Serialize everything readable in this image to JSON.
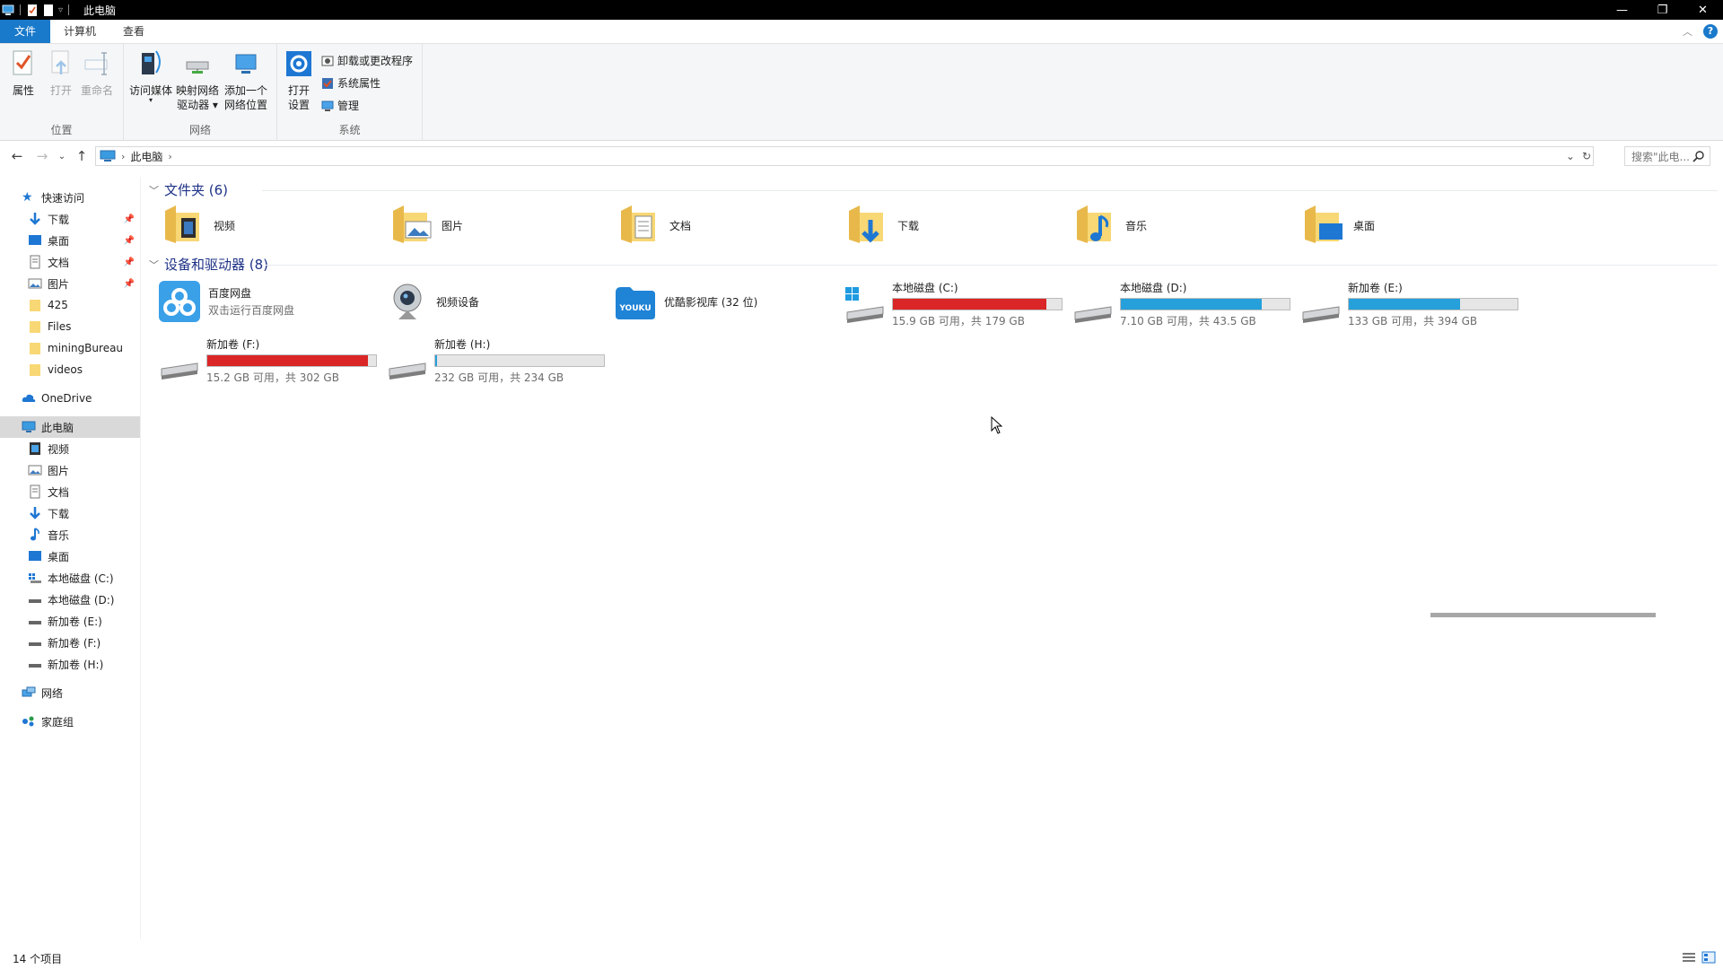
{
  "window": {
    "title": "此电脑",
    "controls": {
      "minimize": "—",
      "restore": "❐",
      "close": "✕"
    }
  },
  "ribbon": {
    "tabs": [
      "文件",
      "计算机",
      "查看"
    ],
    "location": {
      "label": "位置",
      "properties": "属性",
      "open": "打开",
      "rename": "重命名"
    },
    "network": {
      "label": "网络",
      "access_media": "访问媒体",
      "map_drive_1": "映射网络",
      "map_drive_2": "驱动器 ▾",
      "add_location_1": "添加一个",
      "add_location_2": "网络位置"
    },
    "system": {
      "label": "系统",
      "open_settings_1": "打开",
      "open_settings_2": "设置",
      "uninstall": "卸载或更改程序",
      "sys_props": "系统属性",
      "manage": "管理"
    }
  },
  "address": {
    "crumbs": [
      "此电脑"
    ],
    "search_placeholder": "搜索\"此电..."
  },
  "sidebar": {
    "quick_access": "快速访问",
    "quick_items": [
      "下载",
      "桌面",
      "文档",
      "图片",
      "425",
      "Files",
      "miningBureau",
      "videos"
    ],
    "onedrive": "OneDrive",
    "this_pc": "此电脑",
    "pc_items": [
      "视频",
      "图片",
      "文档",
      "下载",
      "音乐",
      "桌面",
      "本地磁盘 (C:)",
      "本地磁盘 (D:)",
      "新加卷 (E:)",
      "新加卷 (F:)",
      "新加卷 (H:)"
    ],
    "network": "网络",
    "homegroup": "家庭组"
  },
  "folders": {
    "header": "文件夹 (6)",
    "items": [
      "视频",
      "图片",
      "文档",
      "下载",
      "音乐",
      "桌面"
    ]
  },
  "devices": {
    "header": "设备和驱动器 (8)",
    "baidu": {
      "name": "百度网盘",
      "sub": "双击运行百度网盘"
    },
    "camera": {
      "name": "视频设备"
    },
    "youku": {
      "name": "优酷影视库 (32 位)"
    },
    "drives": [
      {
        "name": "本地磁盘 (C:)",
        "sub": "15.9 GB 可用，共 179 GB",
        "used_fraction": 0.911,
        "color": "#da2626"
      },
      {
        "name": "本地磁盘 (D:)",
        "sub": "7.10 GB 可用，共 43.5 GB",
        "used_fraction": 0.837,
        "color": "#26a0da"
      },
      {
        "name": "新加卷 (E:)",
        "sub": "133 GB 可用，共 394 GB",
        "used_fraction": 0.662,
        "color": "#26a0da"
      },
      {
        "name": "新加卷 (F:)",
        "sub": "15.2 GB 可用，共 302 GB",
        "used_fraction": 0.95,
        "color": "#da2626"
      },
      {
        "name": "新加卷 (H:)",
        "sub": "232 GB 可用，共 234 GB",
        "used_fraction": 0.009,
        "color": "#26a0da"
      }
    ]
  },
  "status": {
    "count": "14 个项目"
  }
}
